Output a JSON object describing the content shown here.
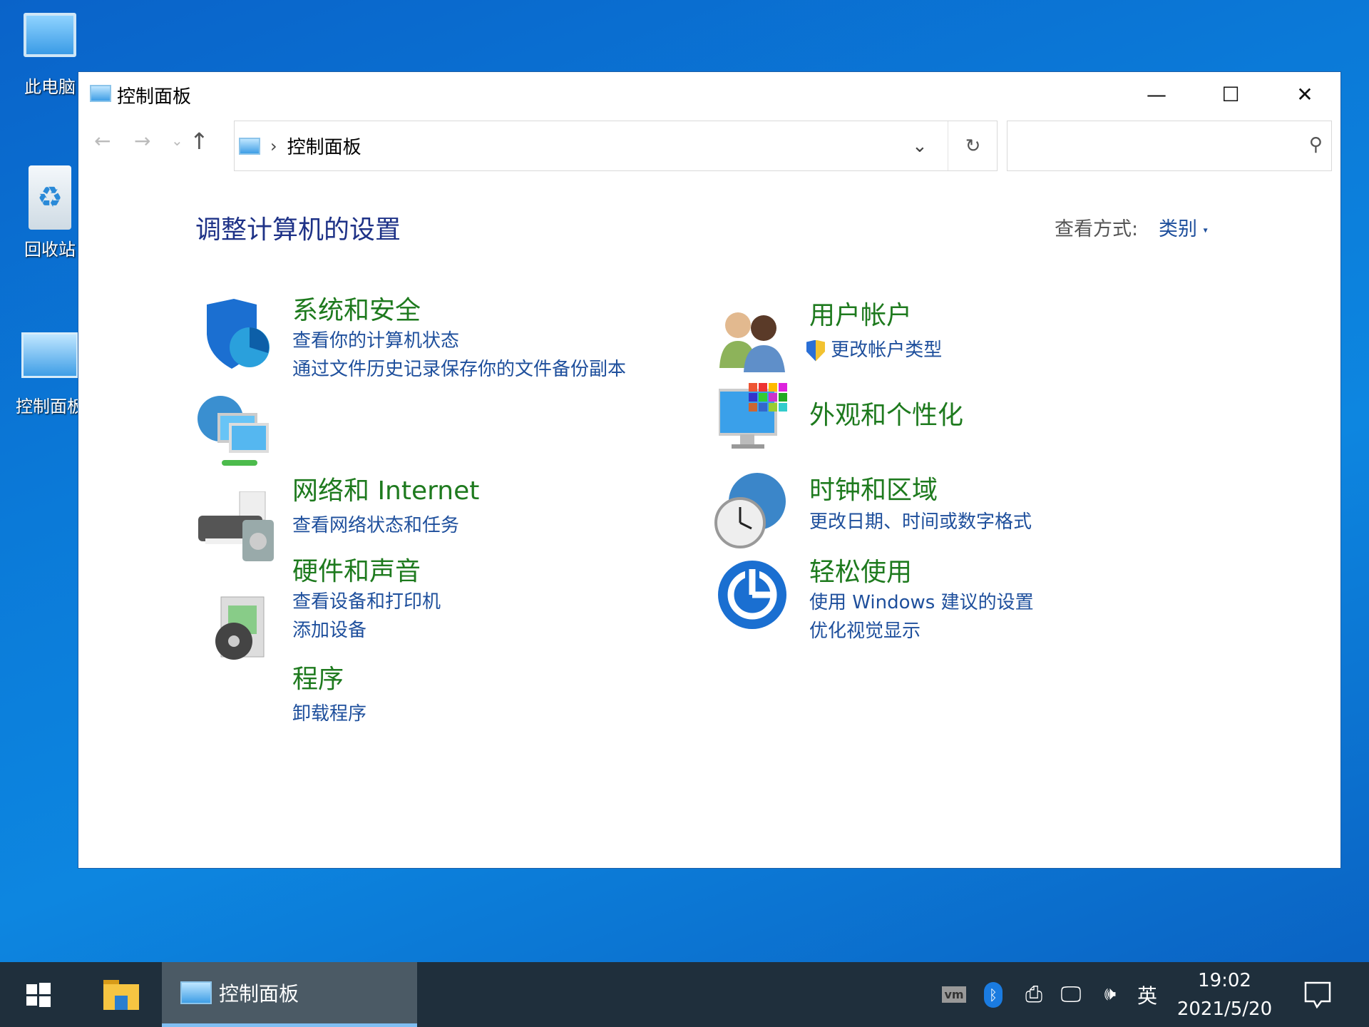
{
  "desktop": {
    "icons": [
      {
        "label": "此电脑"
      },
      {
        "label": "回收站"
      },
      {
        "label": "控制面板"
      }
    ]
  },
  "window": {
    "title": "控制面板",
    "minimize": "—",
    "maximize": "☐",
    "close": "✕"
  },
  "nav": {
    "back": "←",
    "forward": "→",
    "recent": "⌄",
    "up": "↑"
  },
  "address": {
    "separator": "›",
    "crumb": "控制面板",
    "dropdown": "⌄",
    "refresh": "↻"
  },
  "search": {
    "placeholder": "",
    "icon": "search-icon"
  },
  "main": {
    "heading": "调整计算机的设置",
    "view_label": "查看方式:",
    "view_value": "类别",
    "categories": [
      {
        "title": "系统和安全",
        "links": [
          "查看你的计算机状态",
          "通过文件历史记录保存你的文件备份副本"
        ]
      },
      {
        "title": "网络和 Internet",
        "links": [
          "查看网络状态和任务"
        ]
      },
      {
        "title": "硬件和声音",
        "links": [
          "查看设备和打印机",
          "添加设备"
        ]
      },
      {
        "title": "程序",
        "links": [
          "卸载程序"
        ]
      },
      {
        "title": "用户帐户",
        "links": [
          "更改帐户类型"
        ]
      },
      {
        "title": "外观和个性化",
        "links": []
      },
      {
        "title": "时钟和区域",
        "links": [
          "更改日期、时间或数字格式"
        ]
      },
      {
        "title": "轻松使用",
        "links": [
          "使用 Windows 建议的设置",
          "优化视觉显示"
        ]
      }
    ]
  },
  "taskbar": {
    "active_app": "控制面板",
    "tray": {
      "vm": "vm",
      "ime": "英",
      "time": "19:02",
      "date": "2021/5/20"
    }
  },
  "colors": {
    "title_green": "#1e7a1e",
    "link_blue": "#1e4f9c",
    "heading": "#1e3287"
  }
}
